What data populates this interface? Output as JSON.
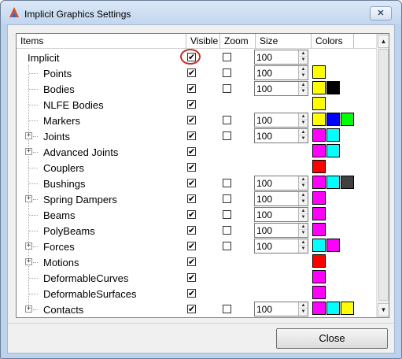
{
  "window": {
    "title": "Implicit Graphics Settings",
    "close_glyph": "✕"
  },
  "table": {
    "columns": [
      "Items",
      "Visible",
      "Zoom",
      "Size",
      "Colors"
    ],
    "rows": [
      {
        "label": "Implicit",
        "level": 0,
        "expander": false,
        "visible": true,
        "zoom": false,
        "size": "100",
        "colors": [],
        "highlighted": true
      },
      {
        "label": "Points",
        "level": 1,
        "expander": false,
        "visible": true,
        "zoom": false,
        "size": "100",
        "colors": [
          "#ffff00"
        ]
      },
      {
        "label": "Bodies",
        "level": 1,
        "expander": false,
        "visible": true,
        "zoom": false,
        "size": "100",
        "colors": [
          "#ffff00",
          "#000000"
        ]
      },
      {
        "label": "NLFE Bodies",
        "level": 1,
        "expander": false,
        "visible": true,
        "zoom": null,
        "size": null,
        "colors": [
          "#ffff00"
        ]
      },
      {
        "label": "Markers",
        "level": 1,
        "expander": false,
        "visible": true,
        "zoom": false,
        "size": "100",
        "colors": [
          "#ffff00",
          "#0000ff",
          "#00ff00"
        ]
      },
      {
        "label": "Joints",
        "level": 1,
        "expander": true,
        "visible": true,
        "zoom": false,
        "size": "100",
        "colors": [
          "#ff00ff",
          "#00ffff"
        ]
      },
      {
        "label": "Advanced Joints",
        "level": 1,
        "expander": true,
        "visible": true,
        "zoom": null,
        "size": null,
        "colors": [
          "#ff00ff",
          "#00ffff"
        ]
      },
      {
        "label": "Couplers",
        "level": 1,
        "expander": false,
        "visible": true,
        "zoom": null,
        "size": null,
        "colors": [
          "#ff0000"
        ]
      },
      {
        "label": "Bushings",
        "level": 1,
        "expander": false,
        "visible": true,
        "zoom": false,
        "size": "100",
        "colors": [
          "#ff00ff",
          "#00ffff",
          "#404040"
        ]
      },
      {
        "label": "Spring Dampers",
        "level": 1,
        "expander": true,
        "visible": true,
        "zoom": false,
        "size": "100",
        "colors": [
          "#ff00ff"
        ]
      },
      {
        "label": "Beams",
        "level": 1,
        "expander": false,
        "visible": true,
        "zoom": false,
        "size": "100",
        "colors": [
          "#ff00ff"
        ]
      },
      {
        "label": "PolyBeams",
        "level": 1,
        "expander": false,
        "visible": true,
        "zoom": false,
        "size": "100",
        "colors": [
          "#ff00ff"
        ]
      },
      {
        "label": "Forces",
        "level": 1,
        "expander": true,
        "visible": true,
        "zoom": false,
        "size": "100",
        "colors": [
          "#00ffff",
          "#ff00ff"
        ]
      },
      {
        "label": "Motions",
        "level": 1,
        "expander": true,
        "visible": true,
        "zoom": null,
        "size": null,
        "colors": [
          "#ff0000"
        ]
      },
      {
        "label": "DeformableCurves",
        "level": 1,
        "expander": false,
        "visible": true,
        "zoom": null,
        "size": null,
        "colors": [
          "#ff00ff"
        ]
      },
      {
        "label": "DeformableSurfaces",
        "level": 1,
        "expander": false,
        "visible": true,
        "zoom": null,
        "size": null,
        "colors": [
          "#ff00ff"
        ]
      },
      {
        "label": "Contacts",
        "level": 1,
        "expander": true,
        "visible": true,
        "zoom": false,
        "size": "100",
        "colors": [
          "#ff00ff",
          "#00ffff",
          "#ffff00"
        ]
      }
    ]
  },
  "icons": {
    "check": "✔",
    "spin_up": "▲",
    "spin_down": "▼",
    "scroll_up": "▲",
    "scroll_down": "▼",
    "expand": "+"
  },
  "footer": {
    "close_label": "Close"
  }
}
